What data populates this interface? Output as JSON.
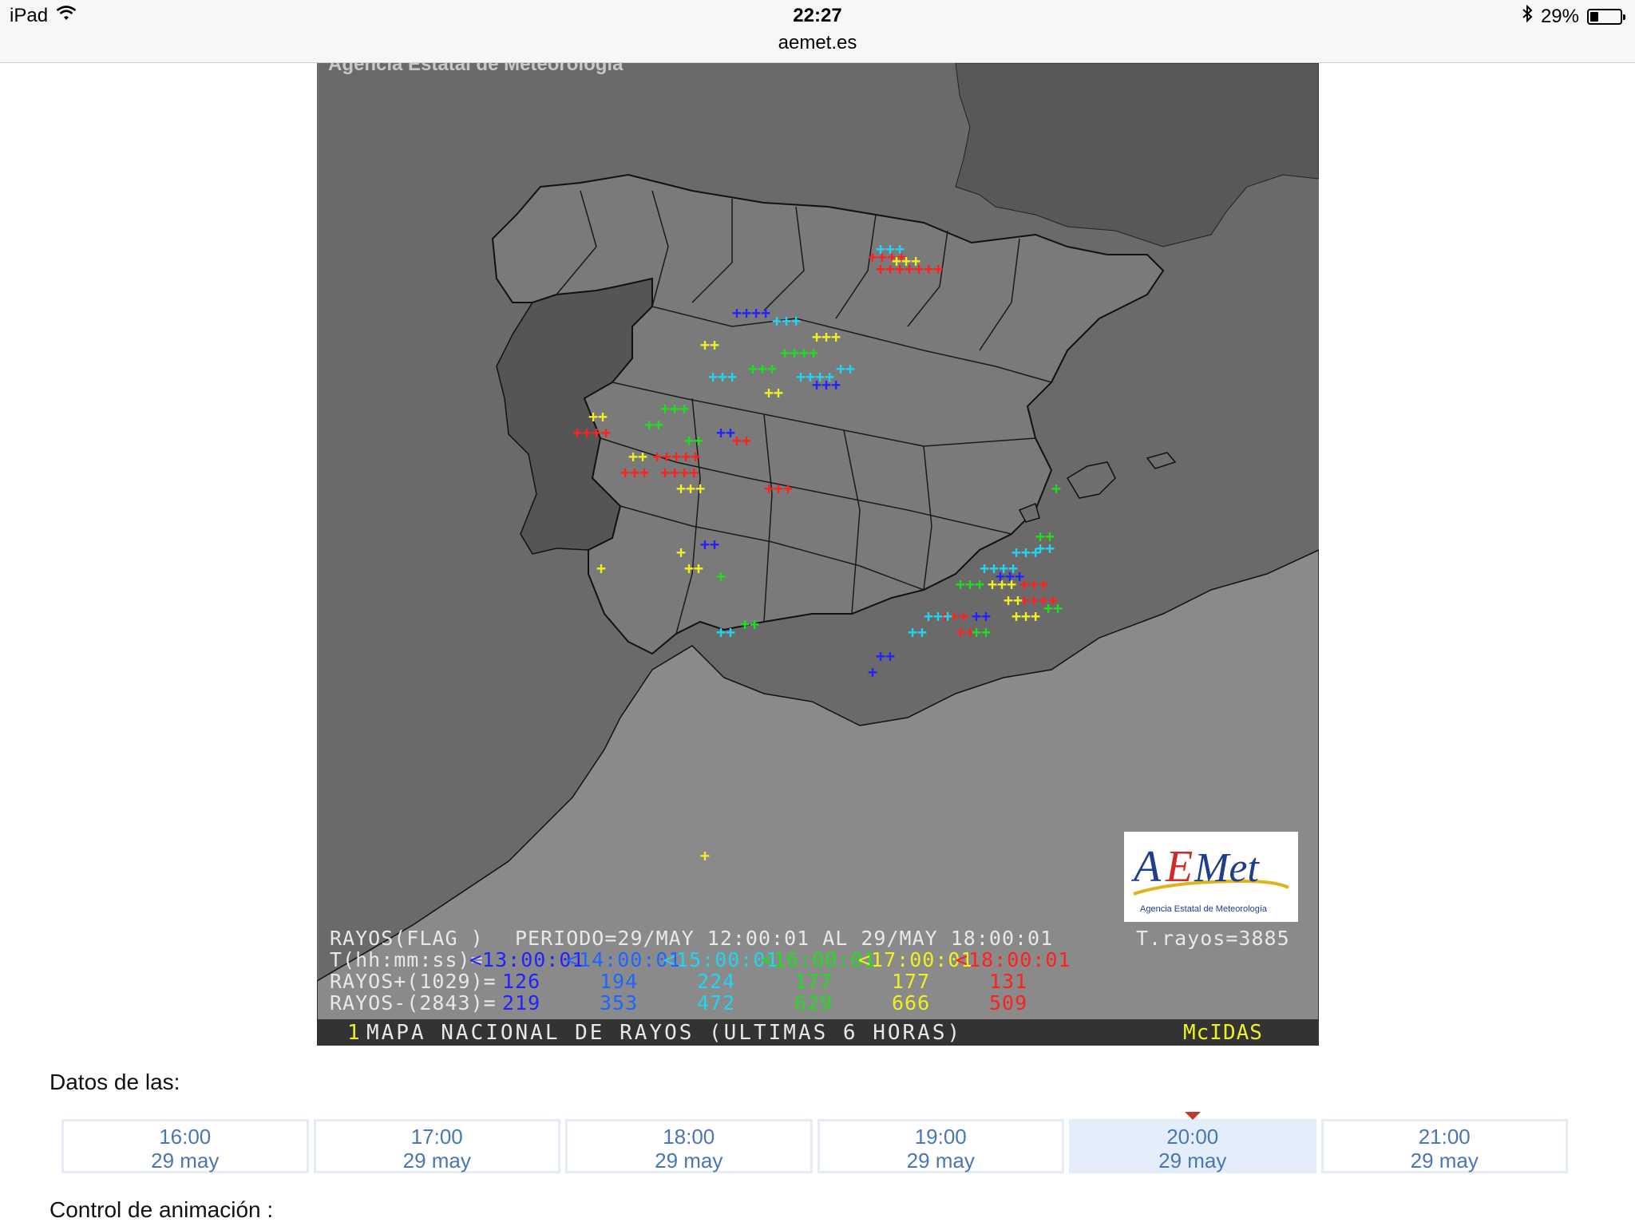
{
  "statusbar": {
    "device": "iPad",
    "time": "22:27",
    "url": "aemet.es",
    "battery": "29%",
    "battery_level": 0.29
  },
  "map": {
    "credit": "Agencia Estatal de Meteorología",
    "legend": {
      "line1_label": "RAYOS(FLAG )",
      "line1_period": "PERIODO=29/MAY 12:00:01 AL 29/MAY 18:00:01",
      "line1_total": "T.rayos=3885",
      "line2_label": "T(hh:mm:ss)=",
      "times": [
        "<13:00:01",
        "<14:00:01",
        "<15:00:01",
        "<16:00:01",
        "<17:00:01",
        "<18:00:01"
      ],
      "line3_label": "RAYOS+(1029)=",
      "pos_values": [
        "126",
        "194",
        "224",
        "177",
        "177",
        "131"
      ],
      "line4_label": "RAYOS-(2843)=",
      "neg_values": [
        "219",
        "353",
        "472",
        "629",
        "666",
        "509"
      ],
      "colors": [
        "#2222ff",
        "#1e66ff",
        "#22d4f0",
        "#20dd20",
        "#f0f020",
        "#ff2020"
      ]
    },
    "footer_num": "1",
    "footer_title": "MAPA NACIONAL DE RAYOS (ULTIMAS 6 HORAS)",
    "footer_brand": "McIDAS",
    "logo_text": "AEMet",
    "logo_subtext": "Agencia Estatal de Meteorología"
  },
  "datos_label": "Datos de las:",
  "timeslots": [
    {
      "time": "16:00",
      "date": "29 may",
      "active": false
    },
    {
      "time": "17:00",
      "date": "29 may",
      "active": false
    },
    {
      "time": "18:00",
      "date": "29 may",
      "active": false
    },
    {
      "time": "19:00",
      "date": "29 may",
      "active": false
    },
    {
      "time": "20:00",
      "date": "29 may",
      "active": true
    },
    {
      "time": "21:00",
      "date": "29 may",
      "active": false
    }
  ],
  "control_label": "Control de animación :"
}
